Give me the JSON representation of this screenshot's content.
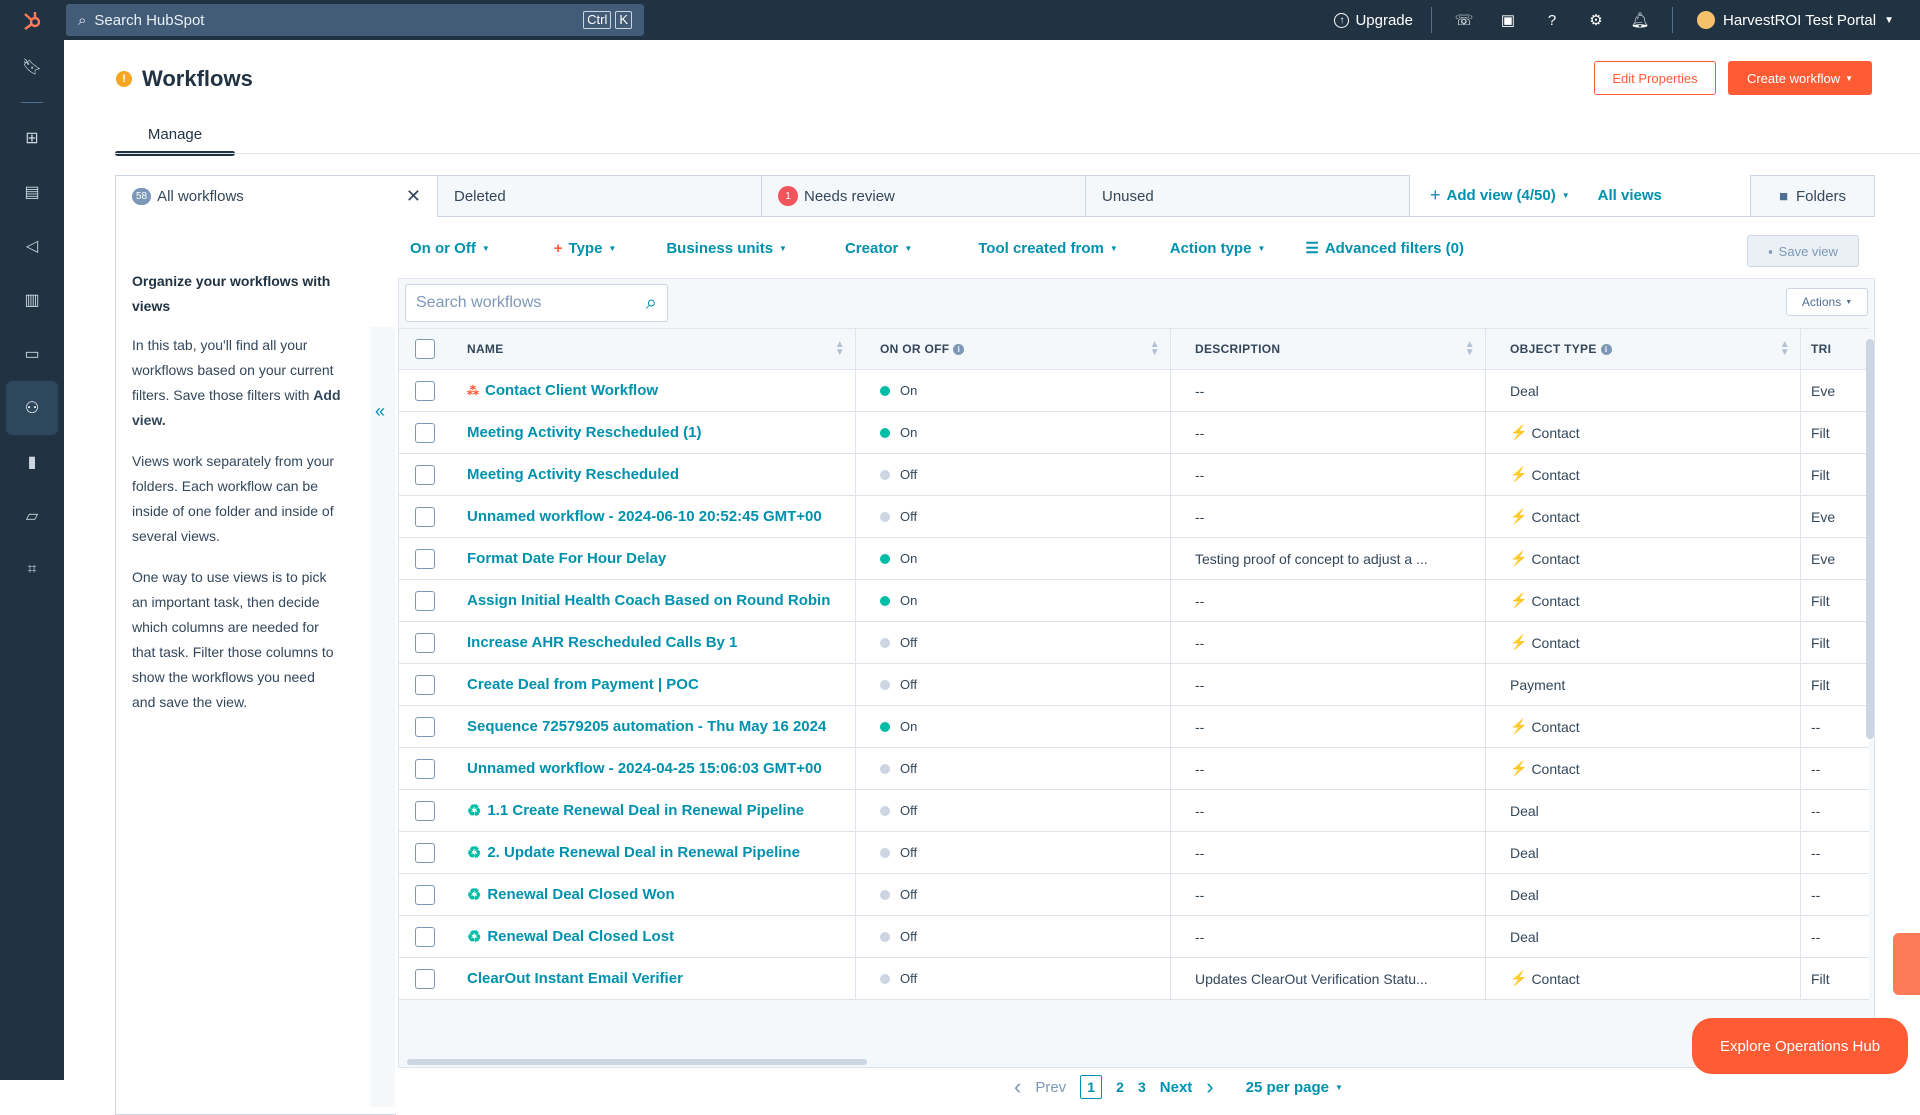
{
  "topbar": {
    "search_placeholder": "Search HubSpot",
    "kbd1": "Ctrl",
    "kbd2": "K",
    "upgrade": "Upgrade",
    "portal": "HarvestROI Test Portal"
  },
  "page": {
    "title": "Workflows",
    "edit_properties": "Edit Properties",
    "create_workflow": "Create workflow",
    "manage_tab": "Manage"
  },
  "views": {
    "all_count": "58",
    "all": "All workflows",
    "deleted": "Deleted",
    "needs_review_count": "1",
    "needs_review": "Needs review",
    "unused": "Unused",
    "add_view": "Add view (4/50)",
    "all_views": "All views",
    "folders": "Folders"
  },
  "panel": {
    "heading": "Organize your workflows with views",
    "p1": "In this tab, you'll find all your workflows based on your current filters. Save those filters with ",
    "p1_bold": "Add view.",
    "p2": "Views work separately from your folders. Each workflow can be inside of one folder and inside of several views.",
    "p3": "One way to use views is to pick an important task, then decide which columns are needed for that task. Filter those columns to show the workflows you need and save the view."
  },
  "filters": {
    "on_off": "On or Off",
    "type": "Type",
    "business_units": "Business units",
    "creator": "Creator",
    "tool_created_from": "Tool created from",
    "action_type": "Action type",
    "advanced": "Advanced filters (0)",
    "save_view": "Save view"
  },
  "table": {
    "search_placeholder": "Search workflows",
    "actions": "Actions",
    "headers": {
      "name": "NAME",
      "on_off": "ON OR OFF",
      "description": "DESCRIPTION",
      "object_type": "OBJECT TYPE",
      "trigger": "TRI"
    },
    "rows": [
      {
        "name": "Contact Client Workflow",
        "icon": "branch-icon",
        "status": "On",
        "on": true,
        "desc": "--",
        "obj": "Deal",
        "bolt": false,
        "trig": "Eve"
      },
      {
        "name": "Meeting Activity Rescheduled (1)",
        "icon": "",
        "status": "On",
        "on": true,
        "desc": "--",
        "obj": "Contact",
        "bolt": true,
        "trig": "Filt"
      },
      {
        "name": "Meeting Activity Rescheduled",
        "icon": "",
        "status": "Off",
        "on": false,
        "desc": "--",
        "obj": "Contact",
        "bolt": true,
        "trig": "Filt"
      },
      {
        "name": "Unnamed workflow - 2024-06-10 20:52:45 GMT+00",
        "icon": "",
        "status": "Off",
        "on": false,
        "desc": "--",
        "obj": "Contact",
        "bolt": true,
        "trig": "Eve"
      },
      {
        "name": "Format Date For Hour Delay",
        "icon": "",
        "status": "On",
        "on": true,
        "desc": "Testing proof of concept to adjust a ...",
        "obj": "Contact",
        "bolt": true,
        "trig": "Eve"
      },
      {
        "name": "Assign Initial Health Coach Based on Round Robin",
        "icon": "",
        "status": "On",
        "on": true,
        "desc": "--",
        "obj": "Contact",
        "bolt": true,
        "trig": "Filt"
      },
      {
        "name": "Increase AHR Rescheduled Calls By 1",
        "icon": "",
        "status": "Off",
        "on": false,
        "desc": "--",
        "obj": "Contact",
        "bolt": true,
        "trig": "Filt"
      },
      {
        "name": "Create Deal from Payment | POC",
        "icon": "",
        "status": "Off",
        "on": false,
        "desc": "--",
        "obj": "Payment",
        "bolt": false,
        "trig": "Filt"
      },
      {
        "name": "Sequence 72579205 automation - Thu May 16 2024",
        "icon": "",
        "status": "On",
        "on": true,
        "desc": "--",
        "obj": "Contact",
        "bolt": true,
        "trig": "--"
      },
      {
        "name": "Unnamed workflow - 2024-04-25 15:06:03 GMT+00",
        "icon": "",
        "status": "Off",
        "on": false,
        "desc": "--",
        "obj": "Contact",
        "bolt": true,
        "trig": "--"
      },
      {
        "name": "1.1 Create Renewal Deal in Renewal Pipeline",
        "icon": "recycle-icon",
        "status": "Off",
        "on": false,
        "desc": "--",
        "obj": "Deal",
        "bolt": false,
        "trig": "--"
      },
      {
        "name": "2. Update Renewal Deal in Renewal Pipeline",
        "icon": "recycle-icon",
        "status": "Off",
        "on": false,
        "desc": "--",
        "obj": "Deal",
        "bolt": false,
        "trig": "--"
      },
      {
        "name": "Renewal Deal Closed Won",
        "icon": "recycle-icon",
        "status": "Off",
        "on": false,
        "desc": "--",
        "obj": "Deal",
        "bolt": false,
        "trig": "--"
      },
      {
        "name": "Renewal Deal Closed Lost",
        "icon": "recycle-icon",
        "status": "Off",
        "on": false,
        "desc": "--",
        "obj": "Deal",
        "bolt": false,
        "trig": "--"
      },
      {
        "name": "ClearOut Instant Email Verifier",
        "icon": "",
        "status": "Off",
        "on": false,
        "desc": "Updates ClearOut Verification Statu...",
        "obj": "Contact",
        "bolt": true,
        "trig": "Filt"
      }
    ]
  },
  "pagination": {
    "prev": "Prev",
    "pages": [
      "1",
      "2",
      "3"
    ],
    "next": "Next",
    "per_page": "25 per page"
  },
  "explore": "Explore Operations Hub",
  "colors": {
    "brand": "#ff5c35",
    "link": "#0091ae",
    "nav": "#213343",
    "on": "#00bda5"
  }
}
